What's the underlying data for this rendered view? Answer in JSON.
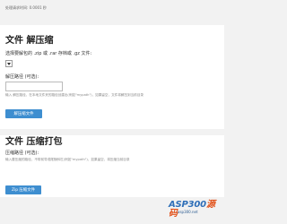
{
  "timing_text": "处理请求时间: 0.0001 秒",
  "extract": {
    "title": "文件 解压缩",
    "select_label": "选择要解包的 .zip 或 .rar 存档或 .gz 文件:",
    "path_label": "解压路径 (可选):",
    "path_value": "",
    "path_hint": "输入 解压路径，在本地文件夹的路径创建出(例如\"mypath\")，如果留空，文件将解压到当前目录",
    "button_label": "解压缩文件"
  },
  "compress": {
    "title": "文件 压缩打包",
    "path_label": "压缩路径 (可选):",
    "path_value": "",
    "path_hint": "输入要压缩的路径，不带前导或尾随斜杠(例如\"mypath\")，如果留空，将压缩当前目录",
    "button_label": "Zip 压缩文件"
  },
  "logo": {
    "main": "ASP300",
    "accent": "源码",
    "sub": "asp300.net"
  }
}
